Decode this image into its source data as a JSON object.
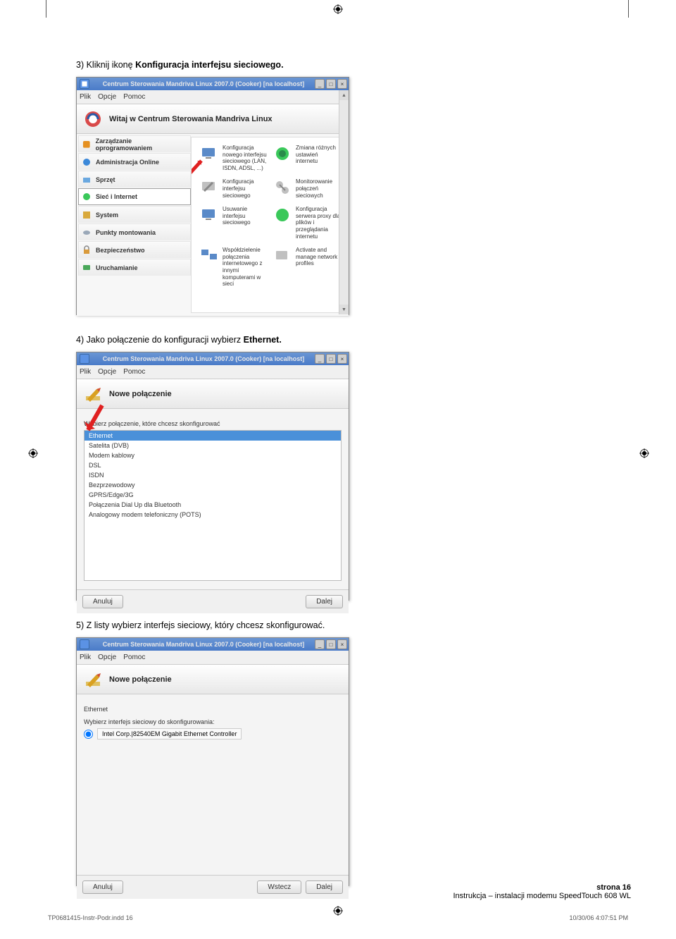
{
  "cropmark_glyph": "⊕",
  "instructions": {
    "step3_pre": "3) Kliknij ikonę ",
    "step3_bold": "Konfiguracja interfejsu sieciowego.",
    "step4_pre": "4) Jako połączenie do konfiguracji wybierz ",
    "step4_bold": "Ethernet.",
    "step5": "5) Z listy wybierz interfejs sieciowy, który chcesz skonfigurować."
  },
  "window": {
    "title": "Centrum Sterowania Mandriva Linux 2007.0 (Cooker) [na localhost]",
    "menu": {
      "file": "Plik",
      "options": "Opcje",
      "help": "Pomoc"
    },
    "min": "_",
    "max": "□",
    "close": "×",
    "sb_up": "▲",
    "sb_down": "▼"
  },
  "screen1": {
    "header": "Witaj w Centrum Sterowania Mandriva Linux",
    "sidebar": [
      "Zarządzanie oprogramowaniem",
      "Administracja Online",
      "Sprzęt",
      "Sieć i Internet",
      "System",
      "Punkty montowania",
      "Bezpieczeństwo",
      "Uruchamianie"
    ],
    "grid": [
      "Konfiguracja nowego interfejsu sieciowego (LAN, ISDN, ADSL, ...)",
      "Zmiana różnych ustawień internetu",
      "Konfiguracja interfejsu sieciowego",
      "Monitorowanie połączeń sieciowych",
      "Usuwanie interfejsu sieciowego",
      "Konfiguracja serwera proxy dla plików i przeglądania internetu",
      "Współdzielenie połączenia internetowego z innymi komputerami w sieci",
      "Activate and manage network profiles"
    ]
  },
  "screen2": {
    "header": "Nowe połączenie",
    "prompt": "Wybierz połączenie, które chcesz skonfigurować",
    "list": [
      "Ethernet",
      "Satelita (DVB)",
      "Modem kablowy",
      "DSL",
      "ISDN",
      "Bezprzewodowy",
      "GPRS/Edge/3G",
      "Połączenia Dial Up dla Bluetooth",
      "Analogowy modem telefoniczny (POTS)"
    ],
    "cancel": "Anuluj",
    "next": "Dalej"
  },
  "screen3": {
    "header": "Nowe połączenie",
    "type": "Ethernet",
    "prompt": "Wybierz interfejs sieciowy do skonfigurowania:",
    "interface": "Intel Corp.|82540EM Gigabit Ethernet Controller",
    "cancel": "Anuluj",
    "back": "Wstecz",
    "next": "Dalej"
  },
  "footer": {
    "page": "strona 16",
    "doc": "Instrukcja – instalacji modemu SpeedTouch 608 WL",
    "indd": "TP0681415-Instr-Podr.indd   16",
    "datetime": "10/30/06   4:07:51 PM"
  }
}
